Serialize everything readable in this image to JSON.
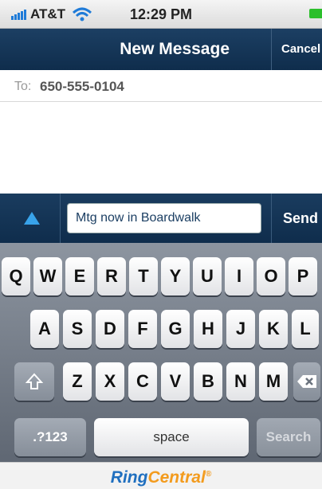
{
  "status_bar": {
    "carrier": "AT&T",
    "time": "12:29 PM",
    "battery_color": "#2bbf2b"
  },
  "nav": {
    "title": "New Message",
    "cancel_label": "Cancel"
  },
  "to_field": {
    "label": "To:",
    "value": "650-555-0104"
  },
  "compose": {
    "message_value": "Mtg now in Boardwalk",
    "send_label": "Send"
  },
  "keyboard": {
    "row1": [
      "Q",
      "W",
      "E",
      "R",
      "T",
      "Y",
      "U",
      "I",
      "O",
      "P"
    ],
    "row2": [
      "A",
      "S",
      "D",
      "F",
      "G",
      "H",
      "J",
      "K",
      "L"
    ],
    "row3": [
      "Z",
      "X",
      "C",
      "V",
      "B",
      "N",
      "M"
    ],
    "numbers_label": ".?123",
    "space_label": "space",
    "search_label": "Search"
  },
  "branding": {
    "part1": "Ring",
    "part2": "Central",
    "trademark": "®"
  }
}
